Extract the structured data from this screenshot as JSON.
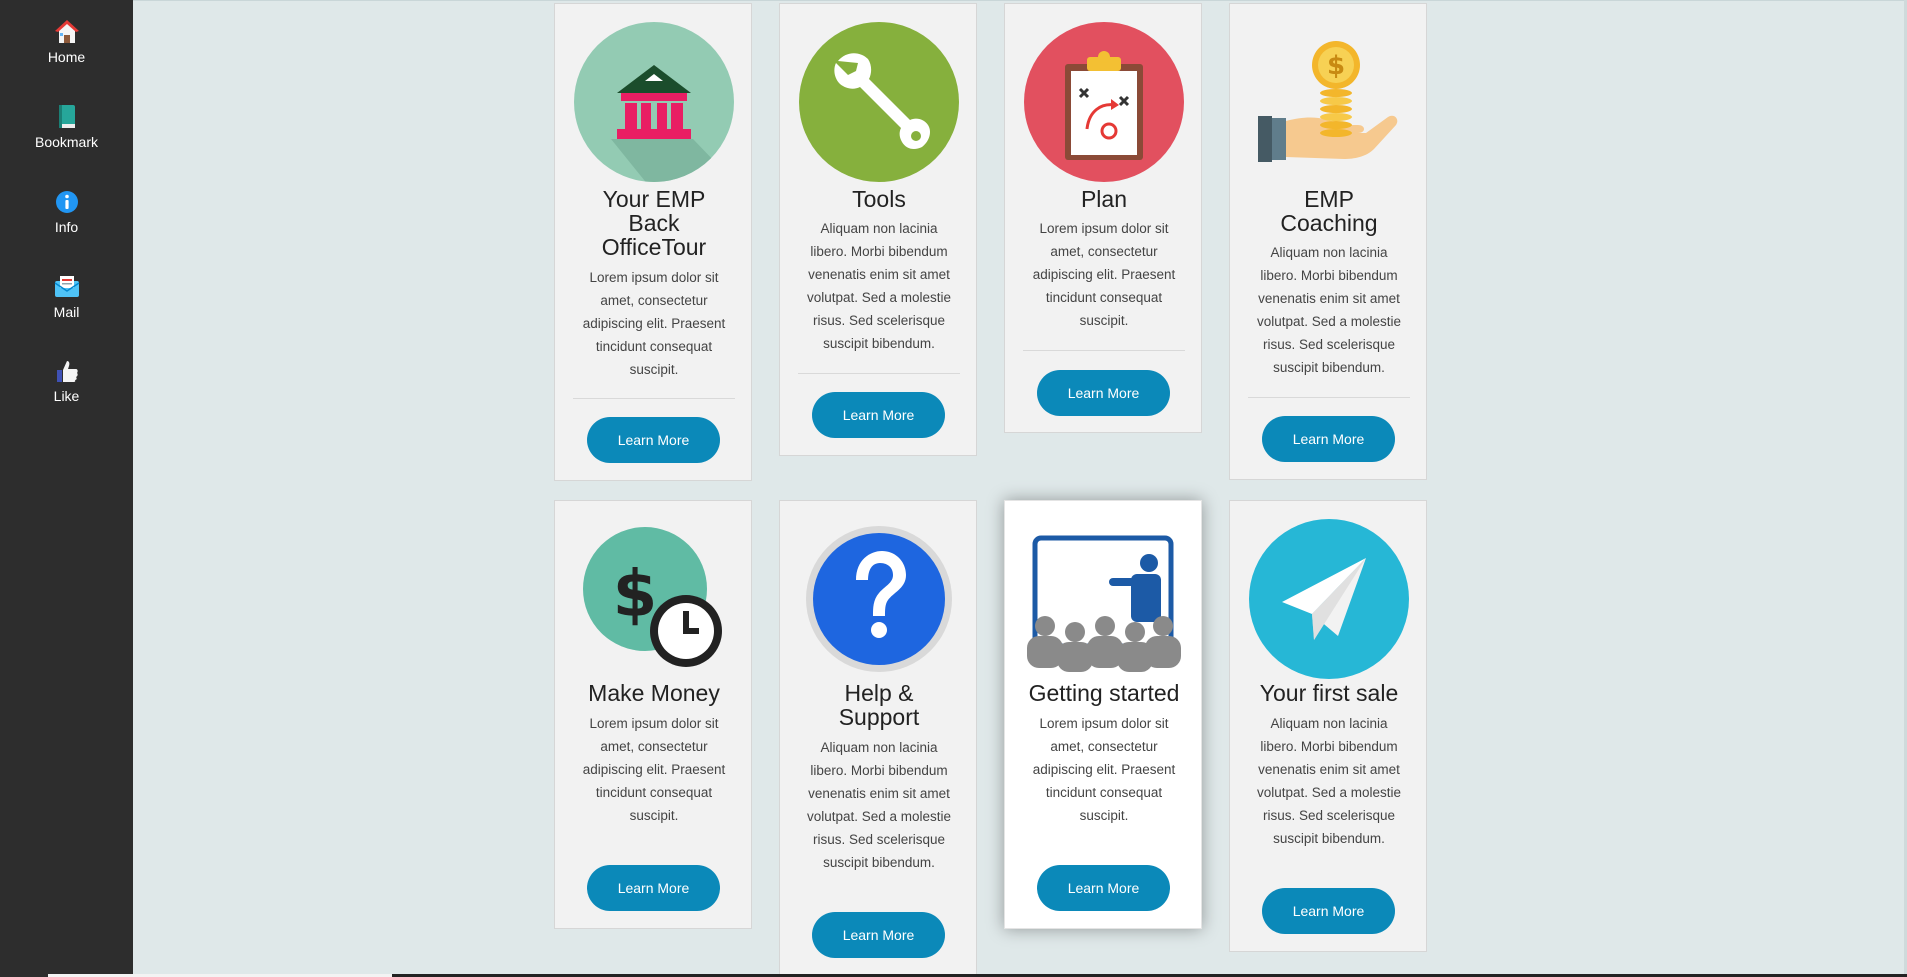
{
  "sidebar": {
    "items": [
      {
        "label": "Home",
        "icon": "home-icon"
      },
      {
        "label": "Bookmark",
        "icon": "bookmark-icon"
      },
      {
        "label": "Info",
        "icon": "info-icon"
      },
      {
        "label": "Mail",
        "icon": "mail-icon"
      },
      {
        "label": "Like",
        "icon": "like-icon"
      }
    ]
  },
  "cards": [
    {
      "title_lines": [
        "Your EMP",
        "Back",
        "OfficeTour"
      ],
      "description": [
        "Lorem ipsum dolor sit",
        "amet, consectetur",
        "adipiscing elit. Praesent",
        "tincidunt consequat",
        "suscipit."
      ],
      "button": "Learn More",
      "icon": "bank-icon"
    },
    {
      "title_lines": [
        "Tools"
      ],
      "description": [
        "Aliquam non lacinia",
        "libero. Morbi bibendum",
        "venenatis enim sit amet",
        "volutpat. Sed a molestie",
        "risus. Sed scelerisque",
        "suscipit bibendum."
      ],
      "button": "Learn More",
      "icon": "wrench-icon"
    },
    {
      "title_lines": [
        "Plan"
      ],
      "description": [
        "Lorem ipsum dolor sit",
        "amet, consectetur",
        "adipiscing elit. Praesent",
        "tincidunt consequat",
        "suscipit."
      ],
      "button": "Learn More",
      "icon": "clipboard-plan-icon"
    },
    {
      "title_lines": [
        "EMP",
        "Coaching"
      ],
      "description": [
        "Aliquam non lacinia",
        "libero. Morbi bibendum",
        "venenatis enim sit amet",
        "volutpat. Sed a molestie",
        "risus. Sed scelerisque",
        "suscipit bibendum."
      ],
      "button": "Learn More",
      "icon": "hand-coins-icon"
    },
    {
      "title_lines": [
        "Make Money"
      ],
      "description": [
        "Lorem ipsum dolor sit",
        "amet, consectetur",
        "adipiscing elit. Praesent",
        "tincidunt consequat",
        "suscipit."
      ],
      "button": "Learn More",
      "icon": "dollar-clock-icon"
    },
    {
      "title_lines": [
        "Help &",
        "Support"
      ],
      "description": [
        "Aliquam non lacinia",
        "libero. Morbi bibendum",
        "venenatis enim sit amet",
        "volutpat. Sed a molestie",
        "risus. Sed scelerisque",
        "suscipit bibendum."
      ],
      "button": "Learn More",
      "icon": "question-icon"
    },
    {
      "title_lines": [
        "Getting started"
      ],
      "description": [
        "Lorem ipsum dolor sit",
        "amet, consectetur",
        "adipiscing elit. Praesent",
        "tincidunt consequat",
        "suscipit."
      ],
      "button": "Learn More",
      "icon": "presentation-icon"
    },
    {
      "title_lines": [
        "Your first sale"
      ],
      "description": [
        "Aliquam non lacinia",
        "libero. Morbi bibendum",
        "venenatis enim sit amet",
        "volutpat. Sed a molestie",
        "risus. Sed scelerisque",
        "suscipit bibendum."
      ],
      "button": "Learn More",
      "icon": "paper-plane-icon"
    }
  ],
  "colors": {
    "sidebar_bg": "#2d2d2d",
    "page_bg": "#dfe8e9",
    "card_bg": "#f2f2f2",
    "button_bg": "#0b89b9"
  }
}
